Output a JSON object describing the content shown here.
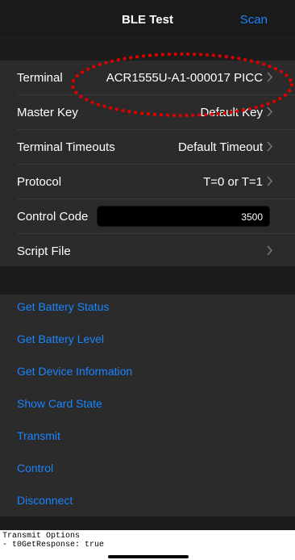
{
  "nav": {
    "title": "BLE Test",
    "scan_label": "Scan"
  },
  "settings": {
    "terminal": {
      "label": "Terminal",
      "value": "ACR1555U-A1-000017 PICC"
    },
    "master_key": {
      "label": "Master Key",
      "value": "Default Key"
    },
    "terminal_timeouts": {
      "label": "Terminal Timeouts",
      "value": "Default Timeout"
    },
    "protocol": {
      "label": "Protocol",
      "value": "T=0 or T=1"
    },
    "control_code": {
      "label": "Control Code",
      "value": "3500"
    },
    "script_file": {
      "label": "Script File"
    }
  },
  "actions": [
    "Get Battery Status",
    "Get Battery Level",
    "Get Device Information",
    "Show Card State",
    "Transmit",
    "Control",
    "Disconnect"
  ],
  "log": {
    "line1": "Transmit Options",
    "line2": "- t0GetResponse: true"
  },
  "colors": {
    "accent": "#1a84ff",
    "annotation": "#e00000"
  }
}
